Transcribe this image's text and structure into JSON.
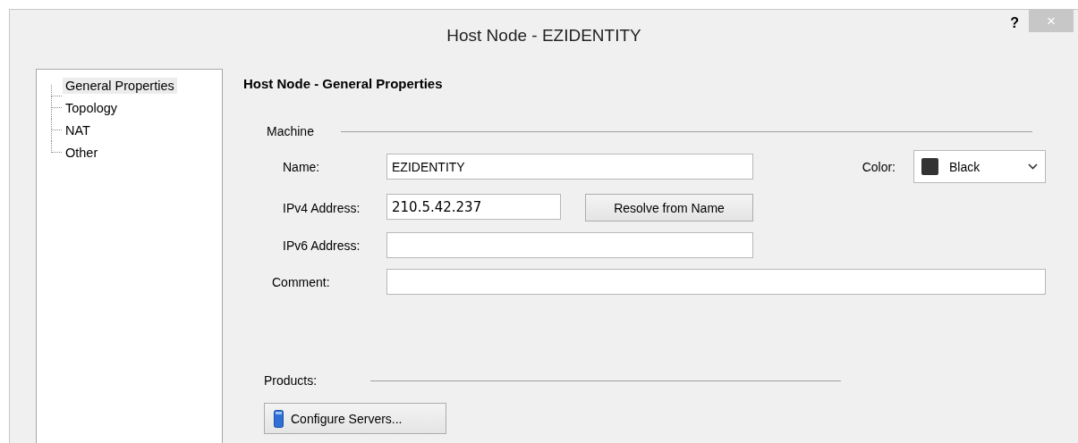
{
  "window": {
    "title": "Host Node - EZIDENTITY",
    "help": "?",
    "close": "×"
  },
  "tree": {
    "items": [
      {
        "label": "General Properties",
        "selected": true
      },
      {
        "label": "Topology",
        "selected": false
      },
      {
        "label": "NAT",
        "selected": false
      },
      {
        "label": "Other",
        "selected": false
      }
    ]
  },
  "heading": "Host Node - General Properties",
  "machine": {
    "label": "Machine",
    "name": {
      "label": "Name:",
      "value": "EZIDENTITY"
    },
    "color": {
      "label": "Color:",
      "value": "Black"
    },
    "ipv4": {
      "label": "IPv4 Address:",
      "value": "210.5.42.237"
    },
    "resolve_button": "Resolve from Name",
    "ipv6": {
      "label": "IPv6 Address:"
    },
    "comment": {
      "label": "Comment:"
    }
  },
  "products": {
    "label": "Products:",
    "button": "Configure Servers..."
  }
}
